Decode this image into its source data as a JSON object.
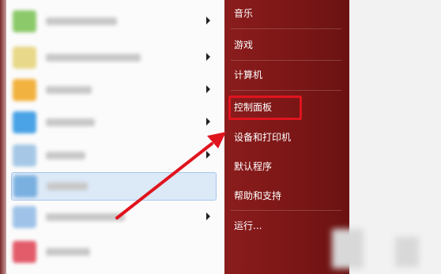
{
  "start_menu": {
    "right_items": [
      {
        "label": "音乐"
      },
      {
        "label": "游戏"
      },
      {
        "label": "计算机"
      },
      {
        "label": "控制面板"
      },
      {
        "label": "设备和打印机"
      },
      {
        "label": "默认程序"
      },
      {
        "label": "帮助和支持"
      },
      {
        "label": "运行..."
      }
    ]
  },
  "colors": {
    "panel_red": "#7a1616",
    "annotation_red": "#e0141e",
    "selection_blue": "#dce9f7"
  }
}
